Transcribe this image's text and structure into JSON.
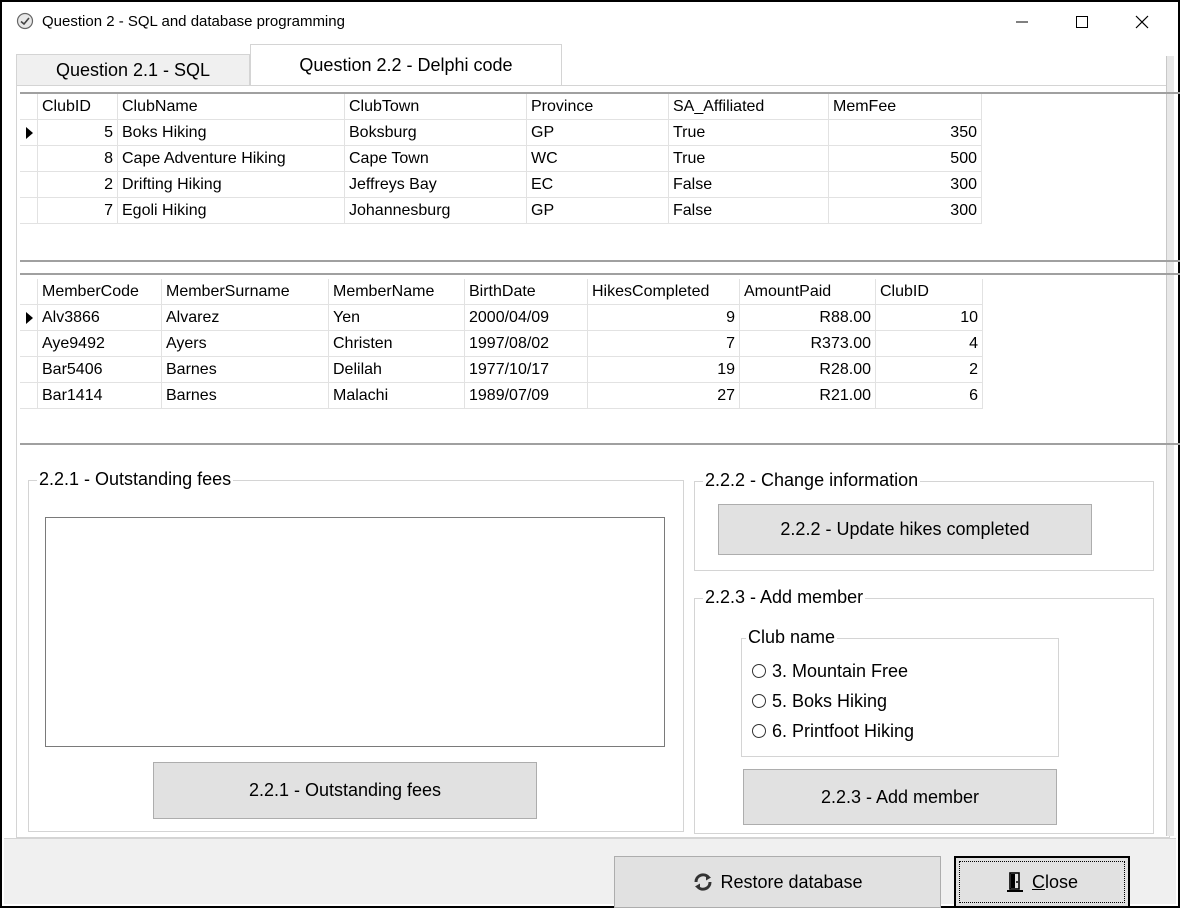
{
  "window": {
    "title": "Question 2 - SQL and database programming"
  },
  "tabs": [
    {
      "label": "Question 2.1 - SQL"
    },
    {
      "label": "Question 2.2 - Delphi code"
    }
  ],
  "clubs_grid": {
    "columns": [
      "ClubID",
      "ClubName",
      "ClubTown",
      "Province",
      "SA_Affiliated",
      "MemFee"
    ],
    "rows": [
      [
        "5",
        "Boks Hiking",
        "Boksburg",
        "GP",
        "True",
        "350"
      ],
      [
        "8",
        "Cape Adventure Hiking",
        "Cape Town",
        "WC",
        "True",
        "500"
      ],
      [
        "2",
        "Drifting Hiking",
        "Jeffreys Bay",
        "EC",
        "False",
        "300"
      ],
      [
        "7",
        "Egoli Hiking",
        "Johannesburg",
        "GP",
        "False",
        "300"
      ]
    ]
  },
  "members_grid": {
    "columns": [
      "MemberCode",
      "MemberSurname",
      "MemberName",
      "BirthDate",
      "HikesCompleted",
      "AmountPaid",
      "ClubID"
    ],
    "rows": [
      [
        "Alv3866",
        "Alvarez",
        "Yen",
        "2000/04/09",
        "9",
        "R88.00",
        "10"
      ],
      [
        "Aye9492",
        "Ayers",
        "Christen",
        "1997/08/02",
        "7",
        "R373.00",
        "4"
      ],
      [
        "Bar5406",
        "Barnes",
        "Delilah",
        "1977/10/17",
        "19",
        "R28.00",
        "2"
      ],
      [
        "Bar1414",
        "Barnes",
        "Malachi",
        "1989/07/09",
        "27",
        "R21.00",
        "6"
      ]
    ]
  },
  "outstanding": {
    "group_label": "2.2.1 - Outstanding fees",
    "button_label": "2.2.1 - Outstanding fees"
  },
  "change": {
    "group_label": "2.2.2 - Change information",
    "button_label": "2.2.2 - Update hikes completed"
  },
  "add_member": {
    "group_label": "2.2.3 - Add member",
    "club_group_label": "Club name",
    "options": [
      "3. Mountain Free",
      "5. Boks Hiking",
      "6. Printfoot Hiking"
    ],
    "button_label": "2.2.3 - Add member"
  },
  "footer": {
    "restore_label": "Restore database",
    "close_label": "Close",
    "restore_icon": "refresh-icon",
    "close_icon": "door-exit-icon"
  }
}
